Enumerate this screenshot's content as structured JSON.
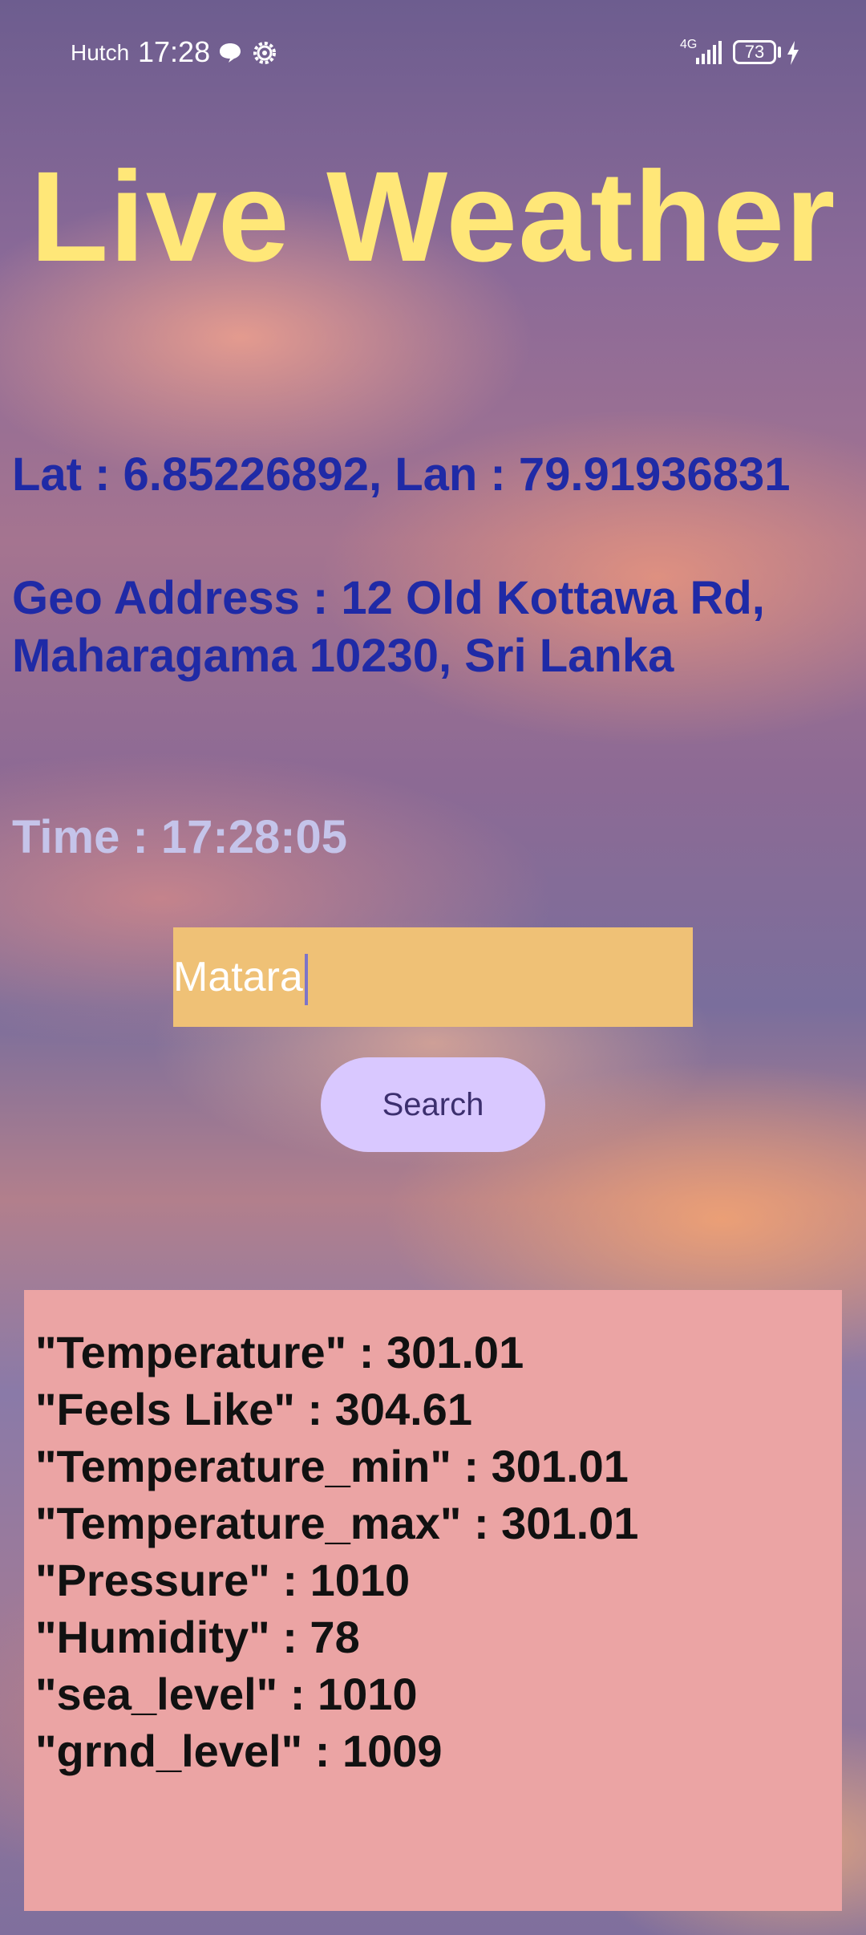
{
  "status_bar": {
    "carrier": "Hutch",
    "time": "17:28",
    "network_label": "4G",
    "battery_level": "73",
    "icons": [
      "chat-icon",
      "gear-icon",
      "signal-icon",
      "battery-icon",
      "bolt-icon"
    ]
  },
  "app": {
    "title": "Live Weather",
    "coordinates_text": "Lat : 6.85226892, Lan : 79.91936831",
    "geo_address_line1": "Geo Address : 12 Old Kottawa Rd,",
    "geo_address_line2": "Maharagama 10230, Sri Lanka",
    "time_text": "Time : 17:28:05"
  },
  "search": {
    "value": "Matara",
    "button_label": "Search"
  },
  "results": [
    "\"Temperature\" : 301.01",
    "\"Feels Like\" : 304.61",
    "\"Temperature_min\" : 301.01",
    "\"Temperature_max\" : 301.01",
    "\"Pressure\" : 1010",
    "\"Humidity\" : 78",
    "\"sea_level\" : 1010",
    "\"grnd_level\" : 1009"
  ],
  "colors": {
    "title": "#ffe778",
    "info_text": "#1f2aa6",
    "time_text": "#c5c4ea",
    "input_bg": "#efc176",
    "button_bg": "#d9c8ff",
    "panel_bg": "#eba4a4"
  }
}
